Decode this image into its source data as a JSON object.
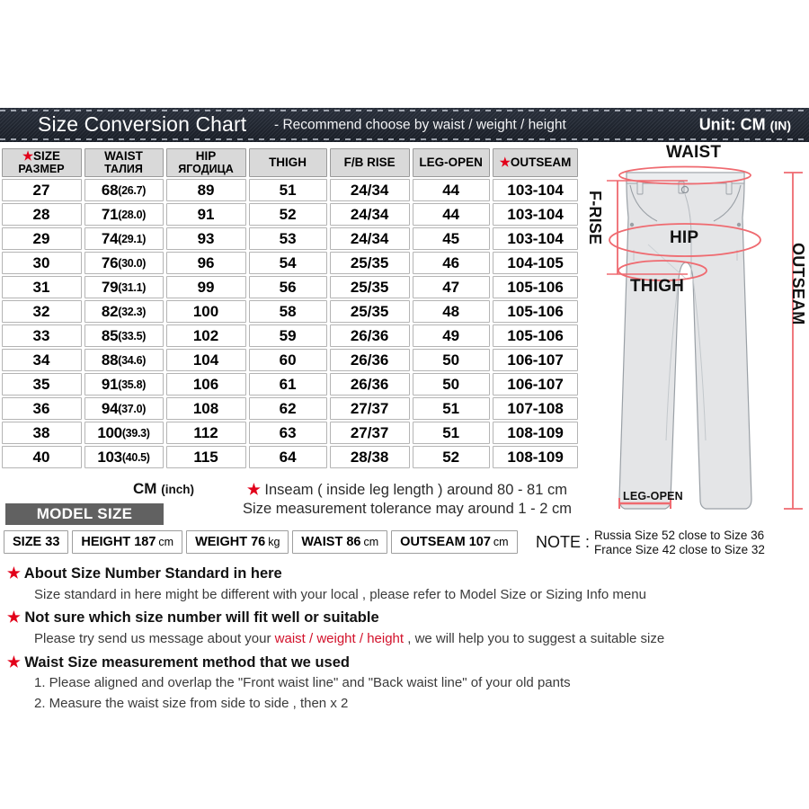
{
  "title": {
    "main": "Size Conversion Chart",
    "sub": "-  Recommend choose by waist / weight / height",
    "unit_prefix": "Unit: CM ",
    "unit_suffix": "(IN)"
  },
  "table": {
    "columns": [
      {
        "star": "★",
        "line1": "SIZE",
        "line2": "РАЗМЕР"
      },
      {
        "star": "",
        "line1": "WAIST",
        "line2": "ТАЛИЯ"
      },
      {
        "star": "",
        "line1": "HIP",
        "line2": "ЯГОДИЦА"
      },
      {
        "star": "",
        "line1": "THIGH",
        "line2": ""
      },
      {
        "star": "",
        "line1": "F/B RISE",
        "line2": ""
      },
      {
        "star": "",
        "line1": "LEG-OPEN",
        "line2": ""
      },
      {
        "star": "★",
        "line1": "OUTSEAM",
        "line2": ""
      }
    ],
    "rows": [
      {
        "size": "27",
        "waist_cm": "68",
        "waist_in": "(26.7)",
        "hip": "89",
        "thigh": "51",
        "fb_rise": "24/34",
        "leg_open": "44",
        "outseam": "103-104"
      },
      {
        "size": "28",
        "waist_cm": "71",
        "waist_in": "(28.0)",
        "hip": "91",
        "thigh": "52",
        "fb_rise": "24/34",
        "leg_open": "44",
        "outseam": "103-104"
      },
      {
        "size": "29",
        "waist_cm": "74",
        "waist_in": "(29.1)",
        "hip": "93",
        "thigh": "53",
        "fb_rise": "24/34",
        "leg_open": "45",
        "outseam": "103-104"
      },
      {
        "size": "30",
        "waist_cm": "76",
        "waist_in": "(30.0)",
        "hip": "96",
        "thigh": "54",
        "fb_rise": "25/35",
        "leg_open": "46",
        "outseam": "104-105"
      },
      {
        "size": "31",
        "waist_cm": "79",
        "waist_in": "(31.1)",
        "hip": "99",
        "thigh": "56",
        "fb_rise": "25/35",
        "leg_open": "47",
        "outseam": "105-106"
      },
      {
        "size": "32",
        "waist_cm": "82",
        "waist_in": "(32.3)",
        "hip": "100",
        "thigh": "58",
        "fb_rise": "25/35",
        "leg_open": "48",
        "outseam": "105-106"
      },
      {
        "size": "33",
        "waist_cm": "85",
        "waist_in": "(33.5)",
        "hip": "102",
        "thigh": "59",
        "fb_rise": "26/36",
        "leg_open": "49",
        "outseam": "105-106"
      },
      {
        "size": "34",
        "waist_cm": "88",
        "waist_in": "(34.6)",
        "hip": "104",
        "thigh": "60",
        "fb_rise": "26/36",
        "leg_open": "50",
        "outseam": "106-107"
      },
      {
        "size": "35",
        "waist_cm": "91",
        "waist_in": "(35.8)",
        "hip": "106",
        "thigh": "61",
        "fb_rise": "26/36",
        "leg_open": "50",
        "outseam": "106-107"
      },
      {
        "size": "36",
        "waist_cm": "94",
        "waist_in": "(37.0)",
        "hip": "108",
        "thigh": "62",
        "fb_rise": "27/37",
        "leg_open": "51",
        "outseam": "107-108"
      },
      {
        "size": "38",
        "waist_cm": "100",
        "waist_in": "(39.3)",
        "hip": "112",
        "thigh": "63",
        "fb_rise": "27/37",
        "leg_open": "51",
        "outseam": "108-109"
      },
      {
        "size": "40",
        "waist_cm": "103",
        "waist_in": "(40.5)",
        "hip": "115",
        "thigh": "64",
        "fb_rise": "28/38",
        "leg_open": "52",
        "outseam": "108-109"
      }
    ]
  },
  "cm_inch": {
    "cm": "CM ",
    "inch": "(inch)"
  },
  "inseam": {
    "star": "★",
    "line1": " Inseam ( inside leg length ) around  80 - 81 cm",
    "line2": "Size measurement tolerance may around 1 - 2 cm"
  },
  "model_size": {
    "label": "MODEL SIZE",
    "items": [
      {
        "text": "SIZE 33",
        "unit": ""
      },
      {
        "text": "HEIGHT 187",
        "unit": "cm"
      },
      {
        "text": "WEIGHT 76",
        "unit": "kg"
      },
      {
        "text": "WAIST 86",
        "unit": "cm"
      },
      {
        "text": "OUTSEAM 107",
        "unit": "cm"
      }
    ]
  },
  "note": {
    "label": "NOTE :",
    "line1": "Russia  Size 52 close to Size 36",
    "line2": "France Size 42 close to Size 32"
  },
  "bottom": {
    "star": "★",
    "head1": "About Size Number Standard in here",
    "sub1": "Size standard in here might be different with your local , please refer to Model Size or Sizing Info menu",
    "head2": "Not sure which size number will fit well or suitable",
    "sub2a": "Please try send us message about your ",
    "sub2_red": "waist / weight / height",
    "sub2b": " , we will help you to suggest a suitable size",
    "head3": "Waist Size measurement method that we used",
    "sub3": "1. Please aligned and overlap the \"Front waist line\" and \"Back waist line\" of your old pants",
    "sub4": "2. Measure the waist size from side to side , then x 2"
  },
  "diagram": {
    "waist": "WAIST",
    "hip": "HIP",
    "thigh": "THIGH",
    "f_rise": "F-RISE",
    "outseam": "OUTSEAM",
    "leg_open": "LEG-OPEN"
  },
  "colors": {
    "denim_dark": "#1c212b",
    "accent_red": "#e2001a",
    "measure_red": "#e8585f",
    "header_gray": "#d9d9d9",
    "model_label_gray": "#616161"
  }
}
